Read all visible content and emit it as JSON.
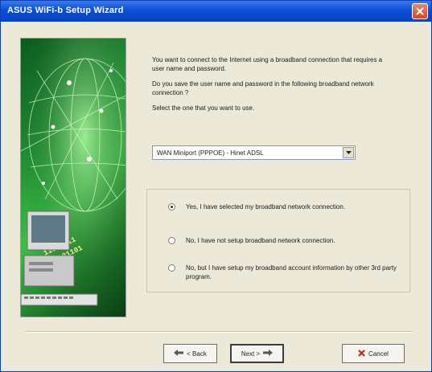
{
  "window": {
    "title": "ASUS WiFi-b Setup Wizard",
    "close_icon": "close-icon"
  },
  "intro": {
    "line1": "You want to connect to the Internet using a broadband connection that requires a user name and password.",
    "line2": "Do you save the user name and password in the following broadband network connection ?",
    "line3": "Select the one that you want to use."
  },
  "connection_select": {
    "selected": "WAN Miniport (PPPOE) - Hinet ADSL"
  },
  "options": [
    {
      "label": "Yes, I have selected my broadband network connection.",
      "checked": true
    },
    {
      "label": "No, I have not setup broadband network connection.",
      "checked": false
    },
    {
      "label": "No, but I have setup my broadband account information by other 3rd party program.",
      "checked": false
    }
  ],
  "buttons": {
    "back_label": "< Back",
    "next_label": "Next >",
    "cancel_label": "Cancel"
  },
  "colors": {
    "titlebar": "#0a4fd9",
    "dialog_bg": "#ece9d8",
    "cancel_x": "#d11f1f"
  }
}
